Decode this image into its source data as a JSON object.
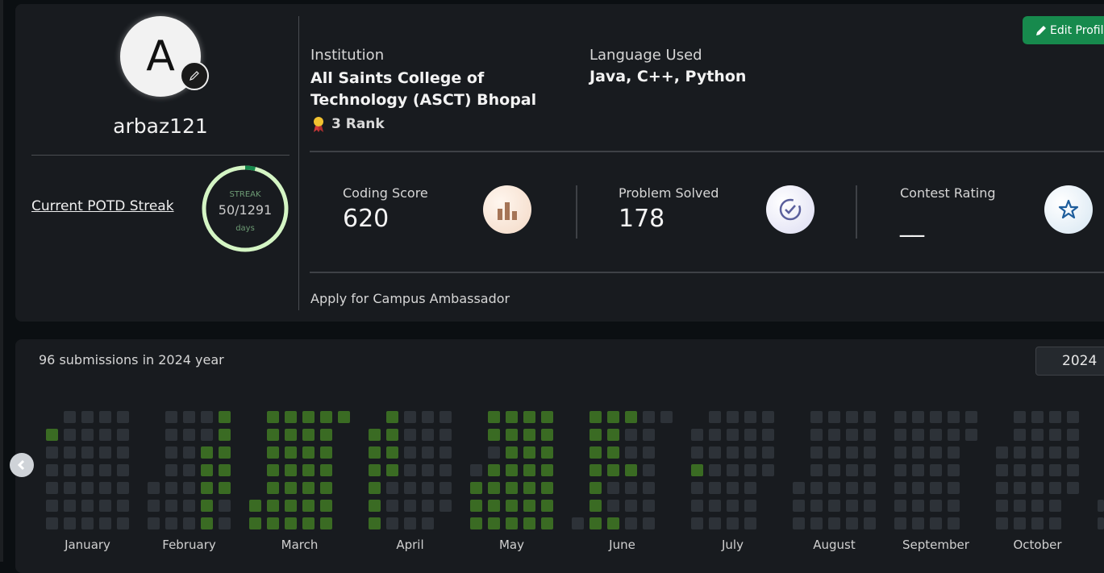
{
  "profile": {
    "avatar_letter": "A",
    "username": "arbaz121",
    "streak_link": "Current POTD Streak",
    "streak_label": "STREAK",
    "streak_count": "50",
    "streak_total": "/1291",
    "streak_days": "days",
    "streak_progress": 0.039
  },
  "details": {
    "institution_label": "Institution",
    "institution_name": "All Saints College of Technology (ASCT) Bhopal",
    "rank_text": "3 Rank",
    "language_label": "Language Used",
    "language_value": "Java, C++, Python",
    "edit_button": "Edit Profile"
  },
  "stats": {
    "coding_score_label": "Coding Score",
    "coding_score_value": "620",
    "problem_solved_label": "Problem Solved",
    "problem_solved_value": "178",
    "contest_rating_label": "Contest Rating",
    "contest_rating_value": "__"
  },
  "ambassador_link": "Apply for Campus Ambassador",
  "heatmap": {
    "summary": "96 submissions in 2024 year",
    "year": "2024",
    "months": [
      "January",
      "February",
      "March",
      "April",
      "May",
      "June",
      "July",
      "August",
      "September",
      "October"
    ]
  },
  "colors": {
    "accent_green": "#178a4d",
    "heatmap_active": "#3a6b23",
    "heatmap_empty": "#2d3238",
    "streak_ring": "#d4f5c4"
  }
}
